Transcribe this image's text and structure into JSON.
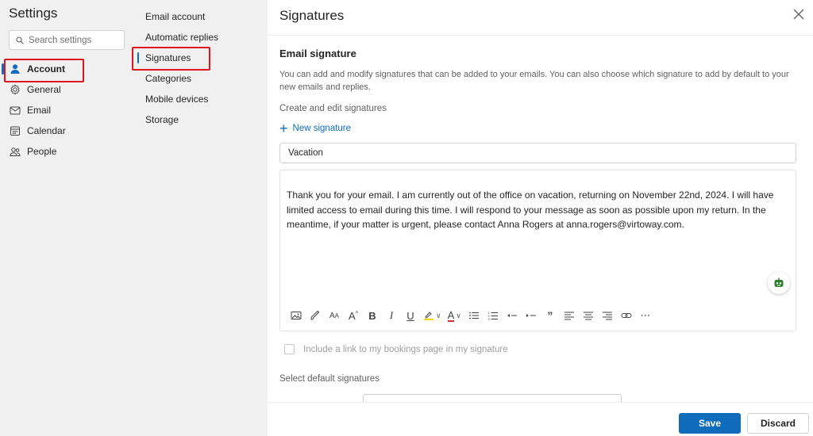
{
  "settings": {
    "title": "Settings",
    "search_placeholder": "Search settings"
  },
  "nav": {
    "items": [
      {
        "label": "Account",
        "icon": "person-icon",
        "active": true
      },
      {
        "label": "General",
        "icon": "gear-icon"
      },
      {
        "label": "Email",
        "icon": "mail-icon"
      },
      {
        "label": "Calendar",
        "icon": "calendar-icon"
      },
      {
        "label": "People",
        "icon": "people-icon"
      }
    ]
  },
  "subnav": {
    "items": [
      {
        "label": "Email account"
      },
      {
        "label": "Automatic replies"
      },
      {
        "label": "Signatures",
        "active": true
      },
      {
        "label": "Categories"
      },
      {
        "label": "Mobile devices"
      },
      {
        "label": "Storage"
      }
    ]
  },
  "panel": {
    "title": "Signatures",
    "section_title": "Email signature",
    "description": "You can add and modify signatures that can be added to your emails. You can also choose which signature to add by default to your new emails and replies.",
    "create_label": "Create and edit signatures",
    "new_signature": "New signature",
    "signature_name": "Vacation",
    "signature_body": "Thank you for your email. I am currently out of the office on vacation, returning on November 22nd, 2024. I will have limited access to email during this time. I will respond to your message as soon as possible upon my return. In the meantime, if your matter is urgent, please contact Anna Rogers at anna.rogers@virtoway.com.",
    "bookings_label": "Include a link to my bookings page in my signature",
    "default_label": "Select default signatures",
    "save_label": "Save",
    "discard_label": "Discard"
  },
  "colors": {
    "accent": "#0f6cbd",
    "highlight_box": "#e0141e"
  }
}
